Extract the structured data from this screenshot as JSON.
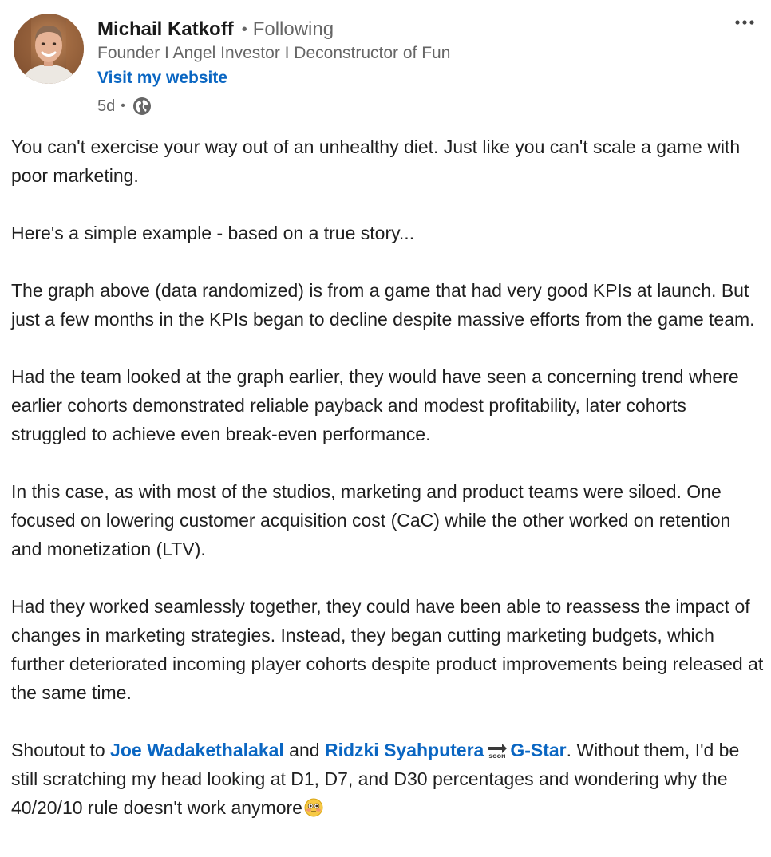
{
  "author": {
    "name": "Michail Katkoff",
    "separator": "•",
    "follow_status": "Following",
    "headline": "Founder I Angel Investor I Deconstructor of Fun",
    "website_label": "Visit my website",
    "time_ago": "5d",
    "meta_separator": "•",
    "visibility_icon": "globe-icon",
    "more_icon": "more-options-icon"
  },
  "post": {
    "paragraphs": [
      "You can't exercise your way out of an unhealthy diet. Just like you can't scale a game with poor marketing.",
      "Here's a simple example - based on a true story...",
      "The graph above (data randomized) is from a game that had very good KPIs at launch. But just a few months in the KPIs began to decline despite massive efforts from the game team.",
      "Had the team looked at the graph earlier, they would have seen a concerning trend where earlier cohorts demonstrated reliable payback and modest profitability, later cohorts struggled to achieve even break-even performance.",
      "In this case, as with most of the studios, marketing and product teams were siloed. One focused on lowering customer acquisition cost (CaC) while the other worked on retention and monetization (LTV).",
      "Had they worked seamlessly together, they could have been able to reassess the impact of changes in marketing strategies. Instead, they began cutting marketing budgets, which further deteriorated incoming player cohorts despite product improvements being released at the same time."
    ],
    "shoutout": {
      "prefix": "Shoutout to ",
      "mention_1": "Joe Wadakethalakal",
      "connector": " and ",
      "mention_2_name": "Ridzki Syahputera",
      "mention_2_icon": "soon-arrow-icon",
      "mention_2_company": "G-Star",
      "suffix": ". Without them, I'd be still scratching my head looking at D1, D7, and D30 percentages and wondering why the 40/20/10 rule doesn't work anymore",
      "emoji": "flushed-face-icon"
    }
  },
  "colors": {
    "link": "#0a66c2",
    "body_text": "#1f1f1f",
    "secondary_text": "#666666",
    "background": "#ffffff"
  }
}
